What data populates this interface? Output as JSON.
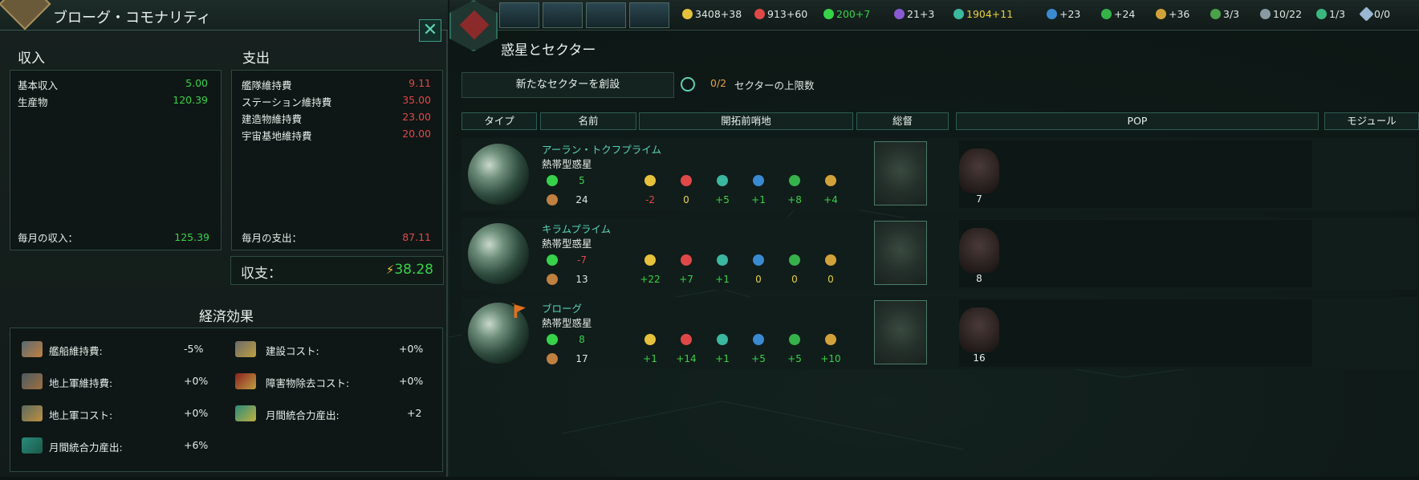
{
  "left_panel": {
    "title": "ブローグ・コモナリティ",
    "close_icon": "close-icon",
    "income": {
      "header": "収入",
      "rows": [
        {
          "label": "基本収入",
          "value": "5.00"
        },
        {
          "label": "生産物",
          "value": "120.39"
        }
      ],
      "total_label": "毎月の収入：",
      "total_value": "125.39"
    },
    "expense": {
      "header": "支出",
      "rows": [
        {
          "label": "艦隊維持費",
          "value": "9.11"
        },
        {
          "label": "ステーション維持費",
          "value": "35.00"
        },
        {
          "label": "建造物維持費",
          "value": "23.00"
        },
        {
          "label": "宇宙基地維持費",
          "value": "20.00"
        }
      ],
      "total_label": "毎月の支出：",
      "total_value": "87.11"
    },
    "balance": {
      "label": "収支：",
      "value": "38.28"
    },
    "effects": {
      "header": "経済効果",
      "items": [
        {
          "label": "艦船維持費:",
          "value": "-5%"
        },
        {
          "label": "建設コスト:",
          "value": "+0%"
        },
        {
          "label": "地上軍維持費:",
          "value": "+0%"
        },
        {
          "label": "障害物除去コスト:",
          "value": "+0%"
        },
        {
          "label": "地上軍コスト:",
          "value": "+0%"
        },
        {
          "label": "月間統合力産出:",
          "value": "+2"
        },
        {
          "label": "月間統合力産出:",
          "value": "+6%"
        }
      ]
    }
  },
  "topbar": {
    "buttons": [
      "government-button",
      "market-button",
      "research-button",
      "situation-button"
    ],
    "resources": [
      {
        "icon": "energy-icon",
        "value": "3408+38",
        "color": "#e6e6e6"
      },
      {
        "icon": "minerals-icon",
        "value": "913+60",
        "color": "#e6e6e6"
      },
      {
        "icon": "food-icon",
        "value": "200+7",
        "color": "#36d24a"
      },
      {
        "icon": "influence-icon",
        "value": "21+3",
        "color": "#e6e6e6"
      },
      {
        "icon": "unity-icon",
        "value": "1904+11",
        "color": "#e6d23c"
      },
      {
        "icon": "physics-icon",
        "value": "+23",
        "color": "#e6e6e6"
      },
      {
        "icon": "society-icon",
        "value": "+24",
        "color": "#e6e6e6"
      },
      {
        "icon": "engineering-icon",
        "value": "+36",
        "color": "#e6e6e6"
      },
      {
        "icon": "planets-icon",
        "value": "3/3",
        "color": "#e6e6e6"
      },
      {
        "icon": "fleet-icon",
        "value": "10/22",
        "color": "#e6e6e6"
      },
      {
        "icon": "starbase-icon",
        "value": "1/3",
        "color": "#e6e6e6"
      },
      {
        "icon": "sector-icon",
        "value": "0/0",
        "color": "#e6e6e6"
      }
    ]
  },
  "right_panel": {
    "title": "惑星とセクター",
    "new_sector_button": "新たなセクターを創設",
    "sector_count": "0/2",
    "sector_limit_label": "セクターの上限数",
    "columns": [
      "タイプ",
      "名前",
      "開拓前哨地",
      "総督",
      "POP",
      "モジュール"
    ],
    "planets": [
      {
        "name": "アーラン・トクフプライム",
        "type": "熱帯型惑星",
        "food": "5",
        "food_color": "#36d24a",
        "stability": "24",
        "energy": "-2",
        "minerals": "0",
        "unity": "+5",
        "physics": "+1",
        "society": "+8",
        "engineering": "+4",
        "pop": "7"
      },
      {
        "name": "キラムプライム",
        "type": "熱帯型惑星",
        "food": "-7",
        "food_color": "#e04848",
        "stability": "13",
        "energy": "+22",
        "minerals": "+7",
        "unity": "+1",
        "physics": "0",
        "society": "0",
        "engineering": "0",
        "pop": "8"
      },
      {
        "name": "ブローグ",
        "type": "熱帯型惑星",
        "food": "8",
        "food_color": "#36d24a",
        "stability": "17",
        "energy": "+1",
        "minerals": "+14",
        "unity": "+1",
        "physics": "+5",
        "society": "+5",
        "engineering": "+10",
        "pop": "16"
      }
    ]
  },
  "colors": {
    "accent": "#58d4b4",
    "positive": "#36d24a",
    "negative": "#e04848",
    "unity": "#e6d23c"
  }
}
